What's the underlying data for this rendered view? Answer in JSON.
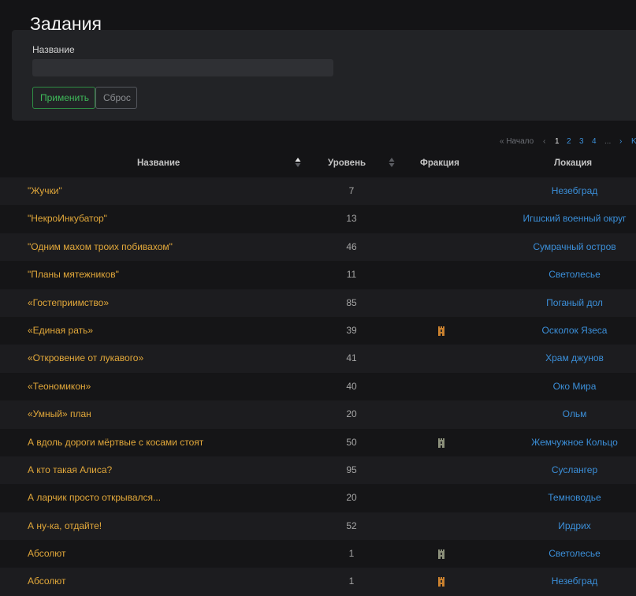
{
  "page": {
    "title": "Задания"
  },
  "filter": {
    "name_label": "Название",
    "name_value": "",
    "apply_label": "Применить",
    "reset_label": "Сброс"
  },
  "pagination": {
    "first": "« Начало",
    "prev": "‹",
    "pages": [
      "1",
      "2",
      "3",
      "4"
    ],
    "current": "1",
    "ellipsis": "...",
    "next": "›",
    "last": "K"
  },
  "table": {
    "headers": {
      "name": "Название",
      "level": "Уровень",
      "faction": "Фракция",
      "location": "Локация"
    },
    "rows": [
      {
        "name": "\"Жучки\"",
        "level": "7",
        "faction_icon": "",
        "location": "Незебград"
      },
      {
        "name": "\"НекроИнкубатор\"",
        "level": "13",
        "faction_icon": "",
        "location": "Игшский военный округ"
      },
      {
        "name": "\"Одним махом троих побивахом\"",
        "level": "46",
        "faction_icon": "",
        "location": "Сумрачный остров"
      },
      {
        "name": "\"Планы мятежников\"",
        "level": "11",
        "faction_icon": "",
        "location": "Светолесье"
      },
      {
        "name": "«Гостеприимство»",
        "level": "85",
        "faction_icon": "",
        "location": "Поганый дол"
      },
      {
        "name": "«Единая рать»",
        "level": "39",
        "faction_icon": "faction-banner-orange-icon",
        "location": "Осколок Язеса"
      },
      {
        "name": "«Откровение от лукавого»",
        "level": "41",
        "faction_icon": "",
        "location": "Храм джунов"
      },
      {
        "name": "«Теономикон»",
        "level": "40",
        "faction_icon": "",
        "location": "Око Мира"
      },
      {
        "name": "«Умный» план",
        "level": "20",
        "faction_icon": "",
        "location": "Ольм"
      },
      {
        "name": "А вдоль дороги мёртвые с косами стоят",
        "level": "50",
        "faction_icon": "faction-banner-gray-icon",
        "location": "Жемчужное Кольцо"
      },
      {
        "name": "А кто такая Алиса?",
        "level": "95",
        "faction_icon": "",
        "location": "Суслангер"
      },
      {
        "name": "А ларчик просто открывался...",
        "level": "20",
        "faction_icon": "",
        "location": "Темноводье"
      },
      {
        "name": "А ну-ка, отдайте!",
        "level": "52",
        "faction_icon": "",
        "location": "Ирдрих"
      },
      {
        "name": "Абсолют",
        "level": "1",
        "faction_icon": "faction-banner-gray-icon",
        "location": "Светолесье"
      },
      {
        "name": "Абсолют",
        "level": "1",
        "faction_icon": "faction-banner-orange-icon",
        "location": "Незебград"
      }
    ]
  },
  "colors": {
    "background": "#141416",
    "quest_name": "#e2a83a",
    "location_link": "#3b8fd9",
    "apply_border": "#2f8d44",
    "faction_orange": "#c9812f",
    "faction_gray": "#8b8f7a"
  }
}
